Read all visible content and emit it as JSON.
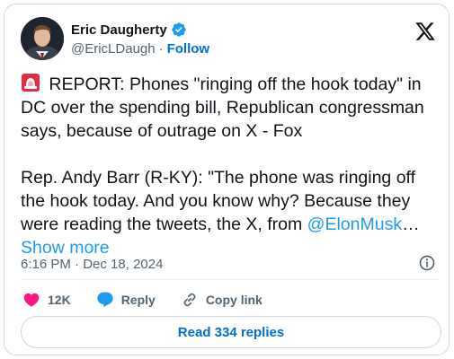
{
  "author": {
    "display_name": "Eric Daugherty",
    "handle": "@EricLDaugh",
    "separator": "·",
    "follow_label": "Follow"
  },
  "tweet": {
    "line1": " REPORT: Phones \"ringing off the hook today\" in DC over the spending bill, Republican congressman says, because of outrage on X - Fox",
    "line2": "Rep. Andy Barr (R-KY): \"The phone was ringing off the hook today. And you know why? Because they were reading the tweets, the X, from ",
    "mention": "@ElonMusk",
    "ellipsis": "… ",
    "show_more": "Show more"
  },
  "meta": {
    "time": "6:16 PM",
    "separator": " · ",
    "date": "Dec 18, 2024"
  },
  "actions": {
    "like_count": "12K",
    "reply_label": "Reply",
    "copy_link_label": "Copy link"
  },
  "replies_button": "Read 334 replies",
  "colors": {
    "accent": "#1d9bf0",
    "link": "#006fd6",
    "like": "#f91880",
    "text": "#0f1419",
    "muted": "#536471"
  },
  "icons": [
    "verified-badge-icon",
    "x-logo-icon",
    "siren-emoji-icon",
    "info-icon",
    "heart-icon",
    "reply-bubble-icon",
    "link-icon"
  ]
}
